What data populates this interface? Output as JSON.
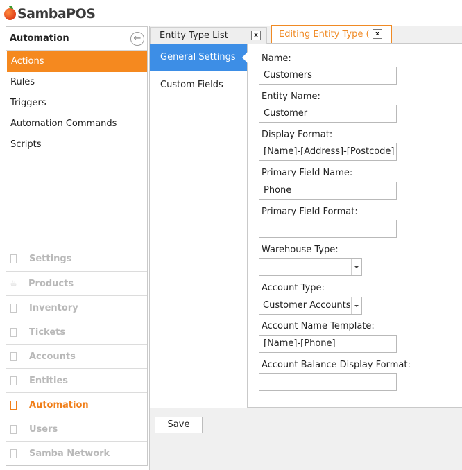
{
  "app": {
    "logo_text": "SambaPOS"
  },
  "nav": {
    "title": "Automation",
    "items": [
      {
        "label": "Actions",
        "active": true
      },
      {
        "label": "Rules"
      },
      {
        "label": "Triggers"
      },
      {
        "label": "Automation Commands"
      },
      {
        "label": "Scripts"
      }
    ],
    "sections": [
      {
        "label": "Settings",
        "icon": "box-icon"
      },
      {
        "label": "Products",
        "icon": "cup-icon"
      },
      {
        "label": "Inventory",
        "icon": "box-icon"
      },
      {
        "label": "Tickets",
        "icon": "box-icon"
      },
      {
        "label": "Accounts",
        "icon": "box-icon"
      },
      {
        "label": "Entities",
        "icon": "box-icon"
      },
      {
        "label": "Automation",
        "icon": "box-icon",
        "active": true
      },
      {
        "label": "Users",
        "icon": "box-icon"
      },
      {
        "label": "Samba Network",
        "icon": "box-icon"
      }
    ]
  },
  "tabs": [
    {
      "label": "Entity Type List",
      "close": "x"
    },
    {
      "label": "Editing Entity Type (Customers)",
      "close": "x",
      "active": true
    }
  ],
  "subnav": [
    {
      "label": "General Settings",
      "selected": true
    },
    {
      "label": "Custom Fields"
    }
  ],
  "form": {
    "name": {
      "label": "Name:",
      "value": "Customers"
    },
    "entity_name": {
      "label": "Entity Name:",
      "value": "Customer"
    },
    "display_format": {
      "label": "Display Format:",
      "value": "[Name]-[Address]-[Postcode]"
    },
    "primary_field_name": {
      "label": "Primary Field Name:",
      "value": "Phone"
    },
    "primary_field_format": {
      "label": "Primary Field Format:",
      "value": ""
    },
    "warehouse_type": {
      "label": "Warehouse Type:",
      "value": ""
    },
    "account_type": {
      "label": "Account Type:",
      "value": "Customer Accounts"
    },
    "account_name_template": {
      "label": "Account Name Template:",
      "value": "[Name]-[Phone]"
    },
    "account_balance_display_format": {
      "label": "Account Balance Display Format:",
      "value": ""
    }
  },
  "footer": {
    "save_label": "Save"
  },
  "colors": {
    "accent": "#f5891f",
    "selection": "#3d8ee6",
    "border": "#c9c9c9"
  }
}
